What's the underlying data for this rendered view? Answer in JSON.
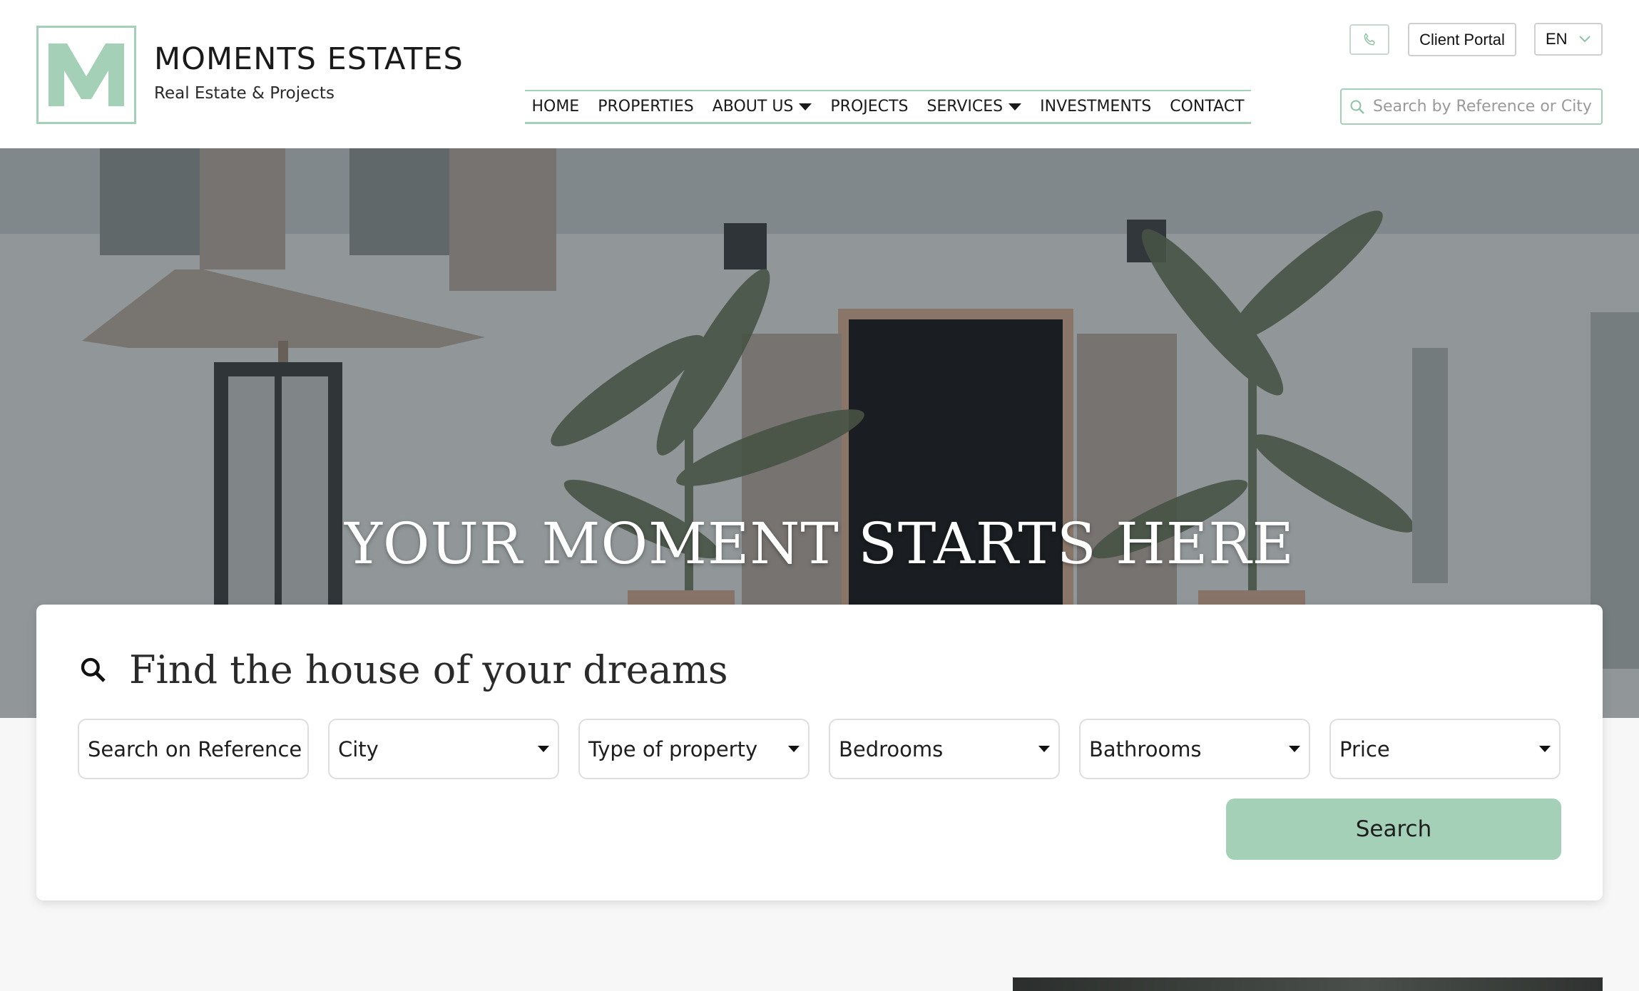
{
  "header": {
    "brand": {
      "title": "MOMENTS ESTATES",
      "subtitle": "Real Estate & Projects",
      "logo_letter": "M",
      "accent_color": "#a3d0b6"
    },
    "nav": [
      {
        "label": "HOME",
        "has_dropdown": false
      },
      {
        "label": "PROPERTIES",
        "has_dropdown": false
      },
      {
        "label": "ABOUT US",
        "has_dropdown": true
      },
      {
        "label": "PROJECTS",
        "has_dropdown": false
      },
      {
        "label": "SERVICES",
        "has_dropdown": true
      },
      {
        "label": "INVESTMENTS",
        "has_dropdown": false
      },
      {
        "label": "CONTACT",
        "has_dropdown": false
      }
    ],
    "phone_icon": "phone-icon",
    "client_portal_label": "Client Portal",
    "language": "EN",
    "search_placeholder": "Search by Reference or City"
  },
  "hero": {
    "title": "YOUR MOMENT STARTS HERE"
  },
  "search_panel": {
    "title": "Find the house of your dreams",
    "reference_placeholder": "Search on Reference",
    "filters": [
      {
        "label": "City"
      },
      {
        "label": "Type of property"
      },
      {
        "label": "Bedrooms"
      },
      {
        "label": "Bathrooms"
      },
      {
        "label": "Price"
      }
    ],
    "search_label": "Search",
    "button_color": "#a3d0b6"
  }
}
